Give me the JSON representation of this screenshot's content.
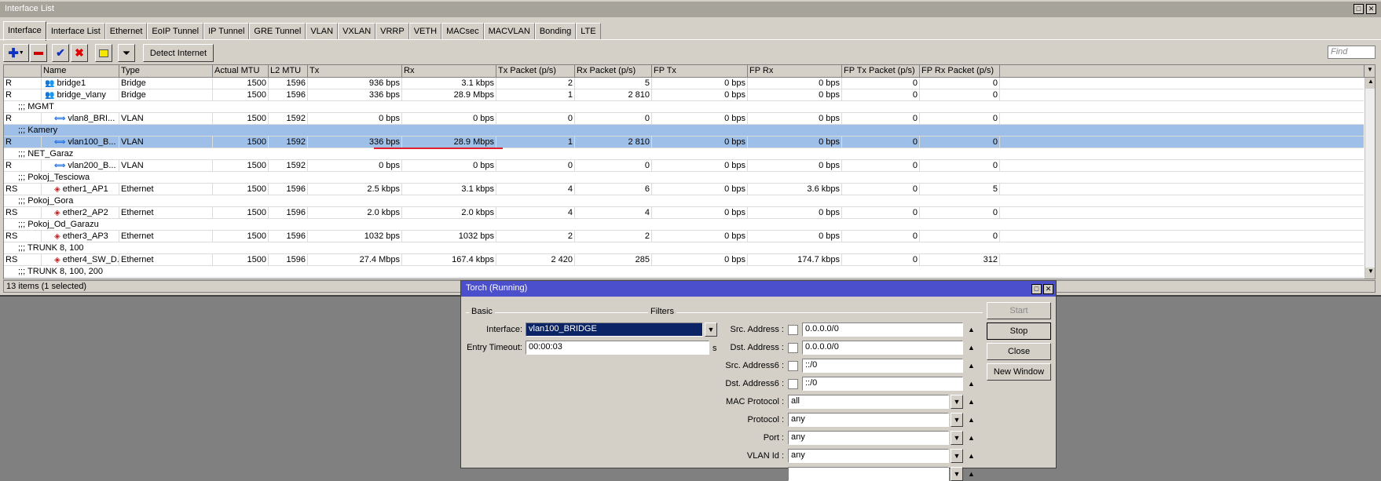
{
  "window": {
    "title": "Interface List"
  },
  "tabs": [
    "Interface",
    "Interface List",
    "Ethernet",
    "EoIP Tunnel",
    "IP Tunnel",
    "GRE Tunnel",
    "VLAN",
    "VXLAN",
    "VRRP",
    "VETH",
    "MACsec",
    "MACVLAN",
    "Bonding",
    "LTE"
  ],
  "toolbar": {
    "detect_label": "Detect Internet",
    "find_placeholder": "Find"
  },
  "columns": [
    "",
    "Name",
    "Type",
    "Actual MTU",
    "L2 MTU",
    "Tx",
    "Rx",
    "Tx Packet (p/s)",
    "Rx Packet (p/s)",
    "FP Tx",
    "FP Rx",
    "FP Tx Packet (p/s)",
    "FP Rx Packet (p/s)"
  ],
  "rows": [
    {
      "flags": "R",
      "name": "bridge1",
      "icon": "bridge",
      "type": "Bridge",
      "mtu": "1500",
      "l2mtu": "1596",
      "tx": "936 bps",
      "rx": "3.1 kbps",
      "txp": "2",
      "rxp": "5",
      "fptx": "0 bps",
      "fprx": "0 bps",
      "fptxp": "0",
      "fprxp": "0"
    },
    {
      "flags": "R",
      "name": "bridge_vlany",
      "icon": "bridge",
      "type": "Bridge",
      "mtu": "1500",
      "l2mtu": "1596",
      "tx": "336 bps",
      "rx": "28.9 Mbps",
      "txp": "1",
      "rxp": "2 810",
      "fptx": "0 bps",
      "fprx": "0 bps",
      "fptxp": "0",
      "fprxp": "0"
    },
    {
      "comment": ";;; MGMT"
    },
    {
      "flags": "R",
      "name": "vlan8_BRI...",
      "icon": "vlan",
      "type": "VLAN",
      "mtu": "1500",
      "l2mtu": "1592",
      "tx": "0 bps",
      "rx": "0 bps",
      "txp": "0",
      "rxp": "0",
      "fptx": "0 bps",
      "fprx": "0 bps",
      "fptxp": "0",
      "fprxp": "0"
    },
    {
      "comment": ";;; Kamery",
      "selected": true
    },
    {
      "flags": "R",
      "name": "vlan100_B...",
      "icon": "vlan",
      "type": "VLAN",
      "mtu": "1500",
      "l2mtu": "1592",
      "tx": "336 bps",
      "rx": "28.9 Mbps",
      "txp": "1",
      "rxp": "2 810",
      "fptx": "0 bps",
      "fprx": "0 bps",
      "fptxp": "0",
      "fprxp": "0",
      "selected": true
    },
    {
      "comment": ";;; NET_Garaz"
    },
    {
      "flags": "R",
      "name": "vlan200_B...",
      "icon": "vlan",
      "type": "VLAN",
      "mtu": "1500",
      "l2mtu": "1592",
      "tx": "0 bps",
      "rx": "0 bps",
      "txp": "0",
      "rxp": "0",
      "fptx": "0 bps",
      "fprx": "0 bps",
      "fptxp": "0",
      "fprxp": "0"
    },
    {
      "comment": ";;; Pokoj_Tesciowa"
    },
    {
      "flags": "RS",
      "name": "ether1_AP1",
      "icon": "ethernet",
      "type": "Ethernet",
      "mtu": "1500",
      "l2mtu": "1596",
      "tx": "2.5 kbps",
      "rx": "3.1 kbps",
      "txp": "4",
      "rxp": "6",
      "fptx": "0 bps",
      "fprx": "3.6 kbps",
      "fptxp": "0",
      "fprxp": "5"
    },
    {
      "comment": ";;; Pokoj_Gora"
    },
    {
      "flags": "RS",
      "name": "ether2_AP2",
      "icon": "ethernet",
      "type": "Ethernet",
      "mtu": "1500",
      "l2mtu": "1596",
      "tx": "2.0 kbps",
      "rx": "2.0 kbps",
      "txp": "4",
      "rxp": "4",
      "fptx": "0 bps",
      "fprx": "0 bps",
      "fptxp": "0",
      "fprxp": "0"
    },
    {
      "comment": ";;; Pokoj_Od_Garazu"
    },
    {
      "flags": "RS",
      "name": "ether3_AP3",
      "icon": "ethernet",
      "type": "Ethernet",
      "mtu": "1500",
      "l2mtu": "1596",
      "tx": "1032 bps",
      "rx": "1032 bps",
      "txp": "2",
      "rxp": "2",
      "fptx": "0 bps",
      "fprx": "0 bps",
      "fptxp": "0",
      "fprxp": "0"
    },
    {
      "comment": ";;; TRUNK 8, 100"
    },
    {
      "flags": "RS",
      "name": "ether4_SW_D...",
      "icon": "ethernet",
      "type": "Ethernet",
      "mtu": "1500",
      "l2mtu": "1596",
      "tx": "27.4 Mbps",
      "rx": "167.4 kbps",
      "txp": "2 420",
      "rxp": "285",
      "fptx": "0 bps",
      "fprx": "174.7 kbps",
      "fptxp": "0",
      "fprxp": "312"
    },
    {
      "comment": ";;; TRUNK 8, 100, 200"
    }
  ],
  "status": "13 items (1 selected)",
  "torch": {
    "title": "Torch (Running)",
    "basic_label": "Basic",
    "filters_label": "Filters",
    "interface_label": "Interface:",
    "interface_value": "vlan100_BRIDGE",
    "timeout_label": "Entry Timeout:",
    "timeout_value": "00:00:03",
    "timeout_unit": "s",
    "filters": [
      {
        "label": "Src. Address :",
        "value": "0.0.0.0/0",
        "kind": "check"
      },
      {
        "label": "Dst. Address :",
        "value": "0.0.0.0/0",
        "kind": "check"
      },
      {
        "label": "Src. Address6 :",
        "value": "::/0",
        "kind": "check"
      },
      {
        "label": "Dst. Address6 :",
        "value": "::/0",
        "kind": "check"
      },
      {
        "label": "MAC Protocol :",
        "value": "all",
        "kind": "select"
      },
      {
        "label": "Protocol :",
        "value": "any",
        "kind": "select"
      },
      {
        "label": "Port :",
        "value": "any",
        "kind": "select"
      },
      {
        "label": "VLAN Id :",
        "value": "any",
        "kind": "select"
      },
      {
        "label": "",
        "value": "",
        "kind": "select"
      }
    ],
    "buttons": {
      "start": "Start",
      "stop": "Stop",
      "close": "Close",
      "new_window": "New Window"
    }
  },
  "colors": {
    "selection": "#9ebfe8",
    "torch_title": "#4b4fcc",
    "highlight": "#e0202a"
  }
}
